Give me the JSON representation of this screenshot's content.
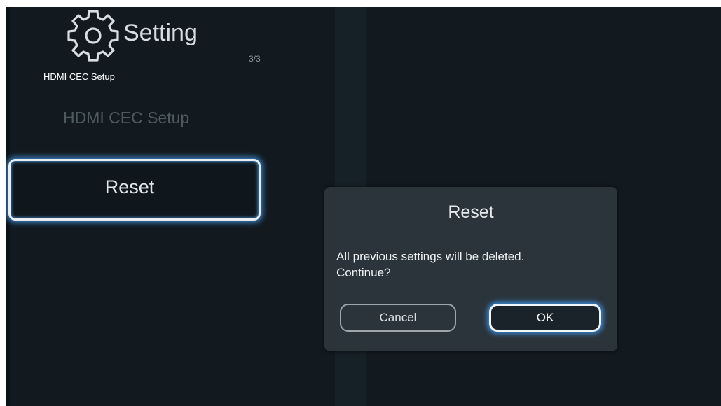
{
  "header": {
    "title": "Setting",
    "icon": "gear-icon",
    "page_indicator": "3/3",
    "caption": "HDMI CEC Setup"
  },
  "menu": {
    "items": [
      {
        "label": "HDMI CEC Setup",
        "state": "dimmed"
      },
      {
        "label": "Reset",
        "state": "selected"
      }
    ]
  },
  "dialog": {
    "title": "Reset",
    "message_line1": "All previous settings will be deleted.",
    "message_line2": "Continue?",
    "cancel_label": "Cancel",
    "ok_label": "OK"
  },
  "colors": {
    "background": "#121a20",
    "dialog_bg": "#2b343b",
    "focus_glow": "#3a86cf"
  }
}
